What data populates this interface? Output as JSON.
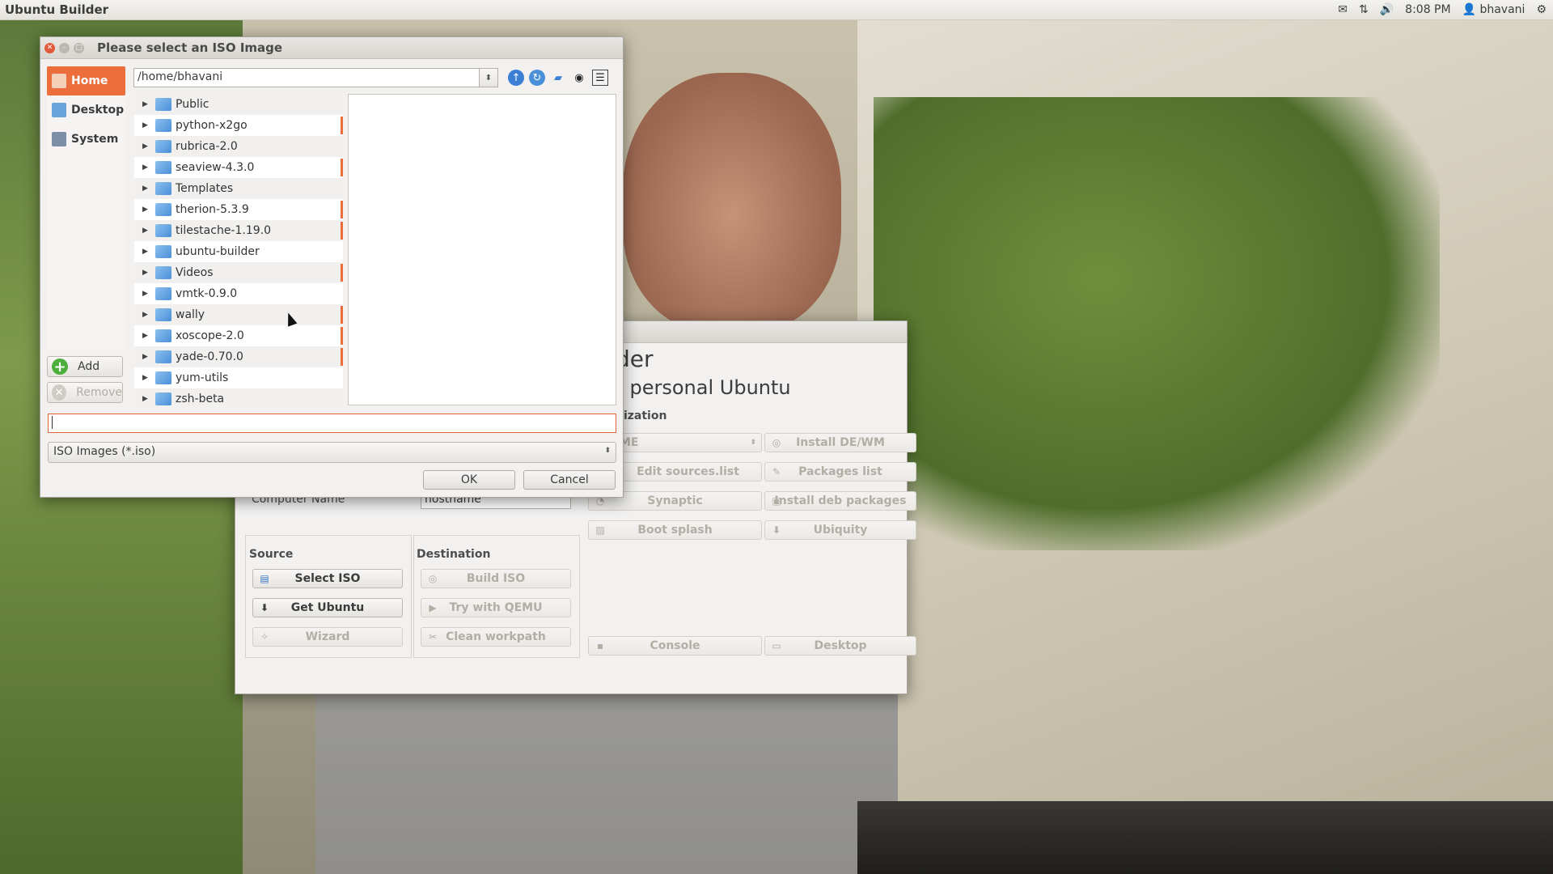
{
  "topbar": {
    "app_title": "Ubuntu Builder",
    "icons": [
      "mail-icon",
      "network-icon",
      "volume-icon",
      "user-icon",
      "gear-icon"
    ],
    "time": "8:08 PM",
    "user": "bhavani"
  },
  "builder": {
    "heading_partial": "der",
    "subheading_partial": "r personal Ubuntu",
    "section_customization_partial": "nization",
    "combo_partial": "ME",
    "computer_name_label": "Computer Name",
    "computer_name_value": "hostname",
    "buttons": {
      "install_dewm": "Install DE/WM",
      "edit_sources": "Edit sources.list",
      "packages_list": "Packages list",
      "synaptic": "Synaptic",
      "install_deb": "Install deb packages",
      "boot_splash": "Boot splash",
      "ubiquity": "Ubiquity",
      "console": "Console",
      "desktop": "Desktop",
      "select_iso": "Select ISO",
      "get_ubuntu": "Get Ubuntu",
      "wizard": "Wizard",
      "build_iso": "Build ISO",
      "try_qemu": "Try with QEMU",
      "clean_workpath": "Clean workpath"
    },
    "source_label": "Source",
    "destination_label": "Destination"
  },
  "dialog": {
    "title": "Please select an ISO Image",
    "path": "/home/bhavani",
    "places": [
      {
        "label": "Home",
        "active": true
      },
      {
        "label": "Desktop",
        "active": false
      },
      {
        "label": "System",
        "active": false
      }
    ],
    "add_label": "Add",
    "remove_label": "Remove",
    "folders": [
      "Public",
      "python-x2go",
      "rubrica-2.0",
      "seaview-4.3.0",
      "Templates",
      "therion-5.3.9",
      "tilestache-1.19.0",
      "ubuntu-builder",
      "Videos",
      "vmtk-0.9.0",
      "wally",
      "xoscope-2.0",
      "yade-0.70.0",
      "yum-utils",
      "zsh-beta"
    ],
    "filename_value": "",
    "filter": "ISO Images (*.iso)",
    "ok_label": "OK",
    "cancel_label": "Cancel",
    "colors": {
      "accent": "#ec6e3c",
      "folder": "#4a8fd8"
    }
  }
}
